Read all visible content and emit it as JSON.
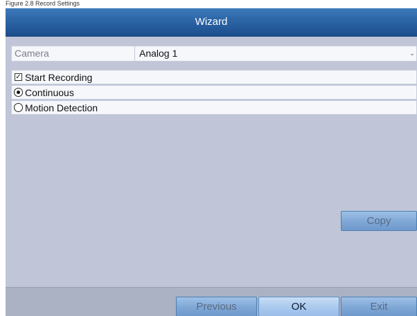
{
  "header_caption": "Figure 2.8 Record Settings",
  "window": {
    "title": "Wizard"
  },
  "camera": {
    "label": "Camera",
    "value": "Analog 1",
    "arrow_icon": "chevron-down-icon"
  },
  "start_recording": {
    "label": "Start Recording",
    "checked": true
  },
  "record_mode": {
    "continuous": {
      "label": "Continuous",
      "selected": true
    },
    "motion_detection": {
      "label": "Motion Detection",
      "selected": false
    }
  },
  "buttons": {
    "copy": "Copy",
    "previous": "Previous",
    "ok": "OK",
    "exit": "Exit"
  },
  "colors": {
    "titlebar": "#2b63a4",
    "background": "#c0c6d8",
    "button": "#7ea7d6",
    "ok_button": "#a9c9ee"
  }
}
